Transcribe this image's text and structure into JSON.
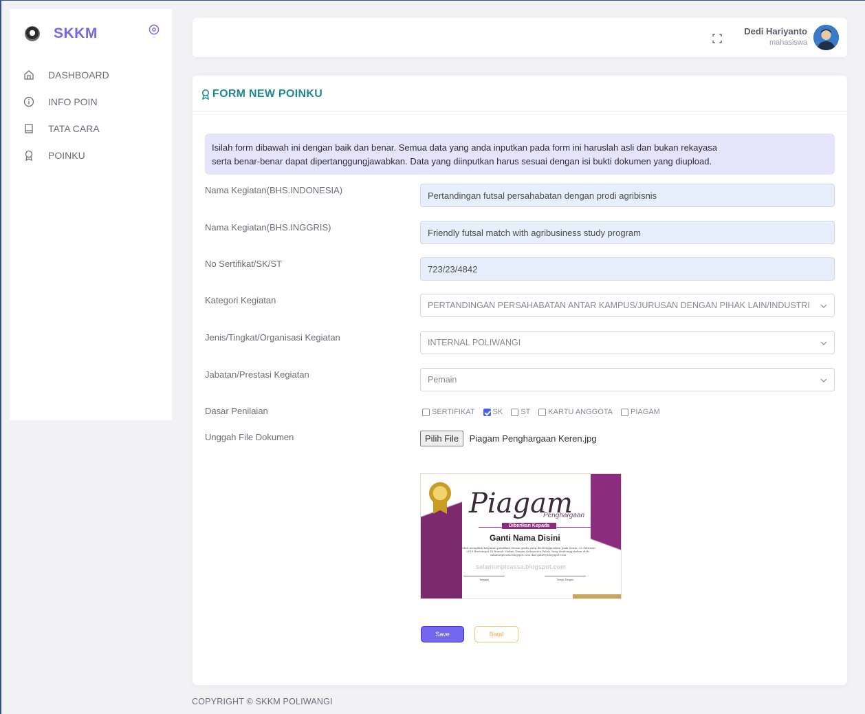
{
  "brand": {
    "name": "SKKM"
  },
  "sidebar": {
    "items": [
      {
        "label": "DASHBOARD",
        "icon": "home-icon"
      },
      {
        "label": "INFO POIN",
        "icon": "info-icon"
      },
      {
        "label": "TATA CARA",
        "icon": "book-icon"
      },
      {
        "label": "POINKU",
        "icon": "award-icon"
      }
    ]
  },
  "header": {
    "user_name": "Dedi Hariyanto",
    "user_role": "mahasiswa"
  },
  "form": {
    "title": "FORM NEW POINKU",
    "notice_line1": "Isilah form dibawah ini dengan baik dan benar. Semua data yang anda inputkan pada form ini haruslah asli dan bukan rekayasa",
    "notice_line2": "serta benar-benar dapat dipertanggungjawabkan. Data yang diinputkan harus sesuai dengan isi bukti dokumen yang diupload.",
    "fields": {
      "nama_id": {
        "label": "Nama Kegiatan(BHS.INDONESIA)",
        "value": "Pertandingan futsal persahabatan dengan prodi agribisnis"
      },
      "nama_en": {
        "label": "Nama Kegiatan(BHS.INGGRIS)",
        "value": "Friendly futsal match with agribusiness study program"
      },
      "no_sertifikat": {
        "label": "No Sertifikat/SK/ST",
        "value": "723/23/4842"
      },
      "kategori": {
        "label": "Kategori Kegiatan",
        "value": "PERTANDINGAN PERSAHABATAN ANTAR KAMPUS/JURUSAN DENGAN PIHAK LAIN/INDUSTRI"
      },
      "jenis": {
        "label": "Jenis/Tingkat/Organisasi Kegiatan",
        "value": "INTERNAL POLIWANGI"
      },
      "jabatan": {
        "label": "Jabatan/Prestasi Kegiatan",
        "value": "Pemain"
      },
      "dasar": {
        "label": "Dasar Penilaian",
        "options": [
          {
            "label": "SERTIFIKAT",
            "checked": false
          },
          {
            "label": "SK",
            "checked": true
          },
          {
            "label": "ST",
            "checked": false
          },
          {
            "label": "KARTU ANGGOTA",
            "checked": false
          },
          {
            "label": "PIAGAM",
            "checked": false
          }
        ]
      },
      "upload": {
        "label": "Unggah File Dokumen",
        "button": "Pilih File",
        "file_name": "Piagam Penghargaan Keren.jpg"
      }
    },
    "preview": {
      "title": "Piagam",
      "subtitle": "Penghargaan",
      "badge": "Diberikan Kepada",
      "name": "Ganti Nama Disini",
      "text": "Telah mengikuti kegiatan pelatihan desain grafis yang diselenggarakan pada Senin, 12 Februari 2018 Bertempat Di Rumah Makan Tangan Kabupaten Pelatr Yang diselenggarakan oleh: salamunpicasa.blogspot.com dan gallery.blogspot.com",
      "watermark": "salamunpicassa.blogspot.com",
      "sig_left": "Tanggal",
      "sig_right": "Tanda Tangan"
    },
    "save_label": "Save",
    "cancel_label": "Batal"
  },
  "footer": {
    "text": "COPYRIGHT © SKKM POLIWANGI"
  },
  "colors": {
    "accent": "#7367f0",
    "title": "#1f8a91",
    "notice_bg": "#e6e4fb",
    "input_bg": "#e8effc"
  }
}
